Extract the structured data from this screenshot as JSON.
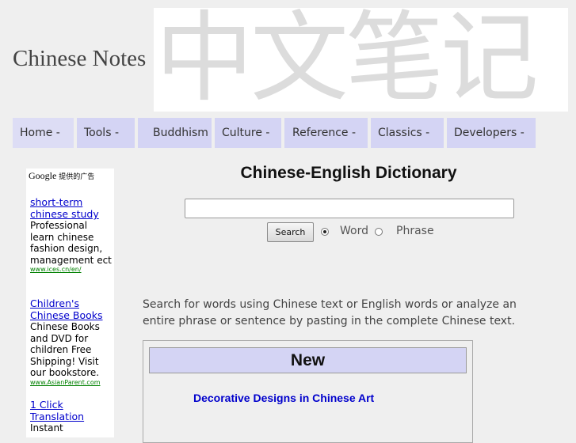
{
  "header": {
    "site_title": "Chinese Notes",
    "banner_text": "中文笔记"
  },
  "nav": {
    "items": [
      {
        "label": "Home -"
      },
      {
        "label": "Tools -"
      },
      {
        "label": "Buddhism"
      },
      {
        "label": "Culture -"
      },
      {
        "label": "Reference -"
      },
      {
        "label": "Classics -"
      },
      {
        "label": "Developers -"
      }
    ]
  },
  "ads": {
    "header_brand": "Google",
    "header_text": "提供的广告",
    "items": [
      {
        "title": "short-term chinese study",
        "desc": "Professional learn chinese fashion design, management ect",
        "url": "www.ices.cn/en/"
      },
      {
        "title": "Children's Chinese Books",
        "desc": "Chinese Books and DVD for children Free Shipping! Visit our bookstore.",
        "url": "www.AsianParent.com"
      },
      {
        "title": "1 Click Translation",
        "desc": "Instant",
        "url": ""
      }
    ]
  },
  "main": {
    "title": "Chinese-English Dictionary",
    "search": {
      "value": "",
      "placeholder": "",
      "button_label": "Search"
    },
    "mode_options": [
      {
        "label": "Word",
        "checked": true
      },
      {
        "label": "Phrase",
        "checked": false
      }
    ],
    "intro": "Search for words using Chinese text or English words or analyze an entire phrase or sentence by pasting in the complete Chinese text.",
    "news": {
      "header": "New",
      "link": "Decorative Designs in Chinese Art"
    }
  },
  "colors": {
    "nav_bg": "#d4d4f4",
    "link": "#0000cc",
    "ad_url": "#008000",
    "page_bg": "#efefef"
  }
}
